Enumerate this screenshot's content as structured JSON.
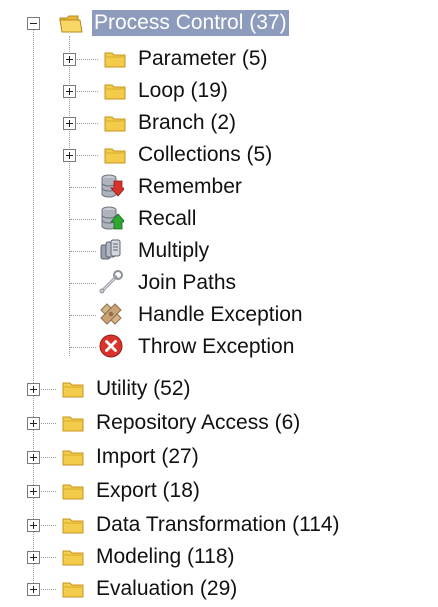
{
  "tree": {
    "root": {
      "label": "Process Control (37)",
      "icon": "folder-open-icon",
      "expanded": true,
      "selected": true
    },
    "children": [
      {
        "label": "Parameter (5)",
        "icon": "folder-icon",
        "expandable": true
      },
      {
        "label": "Loop (19)",
        "icon": "folder-icon",
        "expandable": true
      },
      {
        "label": "Branch (2)",
        "icon": "folder-icon",
        "expandable": true
      },
      {
        "label": "Collections (5)",
        "icon": "folder-icon",
        "expandable": true
      },
      {
        "label": "Remember",
        "icon": "remember-icon",
        "expandable": false
      },
      {
        "label": "Recall",
        "icon": "recall-icon",
        "expandable": false
      },
      {
        "label": "Multiply",
        "icon": "multiply-icon",
        "expandable": false
      },
      {
        "label": "Join Paths",
        "icon": "join-paths-icon",
        "expandable": false
      },
      {
        "label": "Handle Exception",
        "icon": "handle-exception-icon",
        "expandable": false
      },
      {
        "label": "Throw Exception",
        "icon": "throw-exception-icon",
        "expandable": false
      }
    ],
    "siblings": [
      {
        "label": "Utility (52)",
        "icon": "folder-icon",
        "expandable": true
      },
      {
        "label": "Repository Access (6)",
        "icon": "folder-icon",
        "expandable": true
      },
      {
        "label": "Import (27)",
        "icon": "folder-icon",
        "expandable": true
      },
      {
        "label": "Export (18)",
        "icon": "folder-icon",
        "expandable": true
      },
      {
        "label": "Data Transformation (114)",
        "icon": "folder-icon",
        "expandable": true
      },
      {
        "label": "Modeling (118)",
        "icon": "folder-icon",
        "expandable": true
      },
      {
        "label": "Evaluation (29)",
        "icon": "folder-icon",
        "expandable": true
      }
    ]
  },
  "colors": {
    "selection": "#8d9bbd",
    "folder": "#f2cc4a",
    "folder_dark": "#c8951d",
    "error_red": "#d8342c",
    "arrow_green": "#2fa832"
  }
}
